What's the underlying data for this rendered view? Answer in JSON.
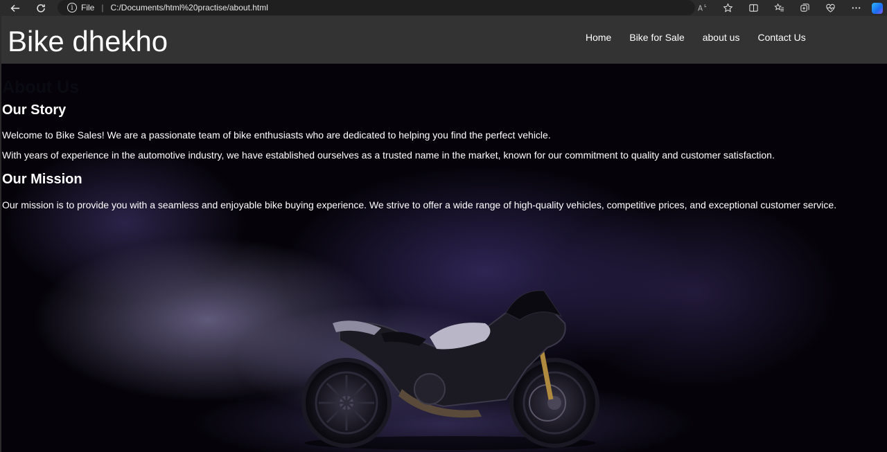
{
  "browser": {
    "file_label": "File",
    "url": "C:/Documents/html%20practise/about.html"
  },
  "site": {
    "logo": "Bike dhekho",
    "nav": [
      "Home",
      "Bike for Sale",
      "about us",
      "Contact Us"
    ]
  },
  "content": {
    "heading": "About Us",
    "story_title": "Our Story",
    "story_p1": "Welcome to Bike Sales! We are a passionate team of bike enthusiasts who are dedicated to helping you find the perfect vehicle.",
    "story_p2": "With years of experience in the automotive industry, we have established ourselves as a trusted name in the market, known for our commitment to quality and customer satisfaction.",
    "mission_title": "Our Mission",
    "mission_p": "Our mission is to provide you with a seamless and enjoyable bike buying experience. We strive to offer a wide range of high-quality vehicles, competitive prices, and exceptional customer service."
  },
  "icons": [
    "back-icon",
    "refresh-icon",
    "info-icon",
    "read-aloud-icon",
    "favorite-star-icon",
    "split-screen-icon",
    "favorites-icon",
    "collections-icon",
    "browser-essentials-icon",
    "more-icon",
    "copilot-icon"
  ],
  "colors": {
    "header_bg": "#333333",
    "chrome_bg": "#2b2b2b",
    "text": "#ffffff"
  }
}
